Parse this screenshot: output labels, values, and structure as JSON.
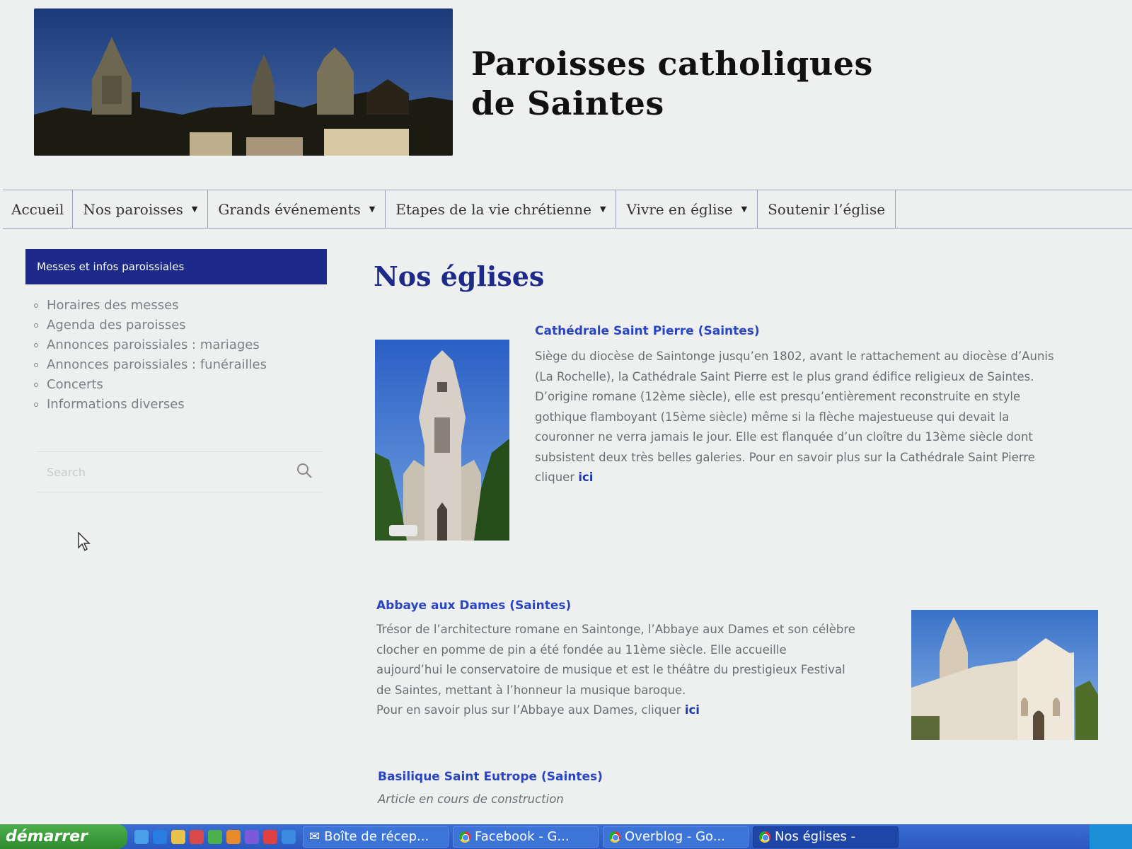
{
  "header": {
    "title_line1": "Paroisses catholiques",
    "title_line2": "de Saintes"
  },
  "nav": [
    {
      "label": "Accueil",
      "has_dropdown": false
    },
    {
      "label": "Nos paroisses",
      "has_dropdown": true
    },
    {
      "label": "Grands événements",
      "has_dropdown": true
    },
    {
      "label": "Etapes de la vie chrétienne",
      "has_dropdown": true
    },
    {
      "label": "Vivre en église",
      "has_dropdown": true
    },
    {
      "label": "Soutenir l’église",
      "has_dropdown": false
    }
  ],
  "sidebar": {
    "widget_title": "Messes et infos paroissiales",
    "items": [
      "Horaires des messes",
      "Agenda des paroisses",
      "Annonces paroissiales : mariages",
      "Annonces paroissiales : funérailles",
      "Concerts",
      "Informations diverses"
    ],
    "search_placeholder": "Search"
  },
  "main": {
    "title": "Nos églises",
    "churches": [
      {
        "name": "Cathédrale Saint Pierre (Saintes)",
        "lines": [
          "Siège du diocèse de Saintonge jusqu’en 1802, avant le rattachement au diocèse d’Aunis",
          "(La Rochelle), la Cathédrale Saint Pierre est le plus grand édifice religieux de Saintes.",
          "D’origine romane (12ème siècle), elle est presqu’entièrement reconstruite en style",
          "gothique flamboyant (15ème siècle) même si la flèche majestueuse qui devait la",
          "couronner ne verra jamais le jour. Elle est flanquée d’un cloître du 13ème siècle dont",
          "subsistent deux très belles galeries. Pour en savoir plus sur la Cathédrale Saint Pierre",
          "cliquer"
        ],
        "link": "ici"
      },
      {
        "name": "Abbaye aux Dames (Saintes)",
        "lines": [
          "Trésor de l’architecture romane en Saintonge, l’Abbaye aux Dames et son célèbre",
          "clocher en pomme de pin a été fondée au 11ème siècle. Elle accueille",
          "aujourd’hui le conservatoire de musique et est le théâtre du prestigieux Festival",
          "de Saintes, mettant à l’honneur la musique baroque.",
          "Pour en savoir plus sur l’Abbaye aux Dames, cliquer"
        ],
        "link": "ici"
      },
      {
        "name": "Basilique Saint Eutrope (Saintes)",
        "lines": [
          "Article en cours de construction"
        ]
      }
    ]
  },
  "taskbar": {
    "start_label": "démarrer",
    "tasks": [
      {
        "label": "Boîte de récep..."
      },
      {
        "label": "Facebook - G..."
      },
      {
        "label": "Overblog - Go..."
      },
      {
        "label": "Nos églises -"
      }
    ]
  },
  "colors": {
    "accent": "#1e2a8a",
    "link": "#2a45c2"
  }
}
